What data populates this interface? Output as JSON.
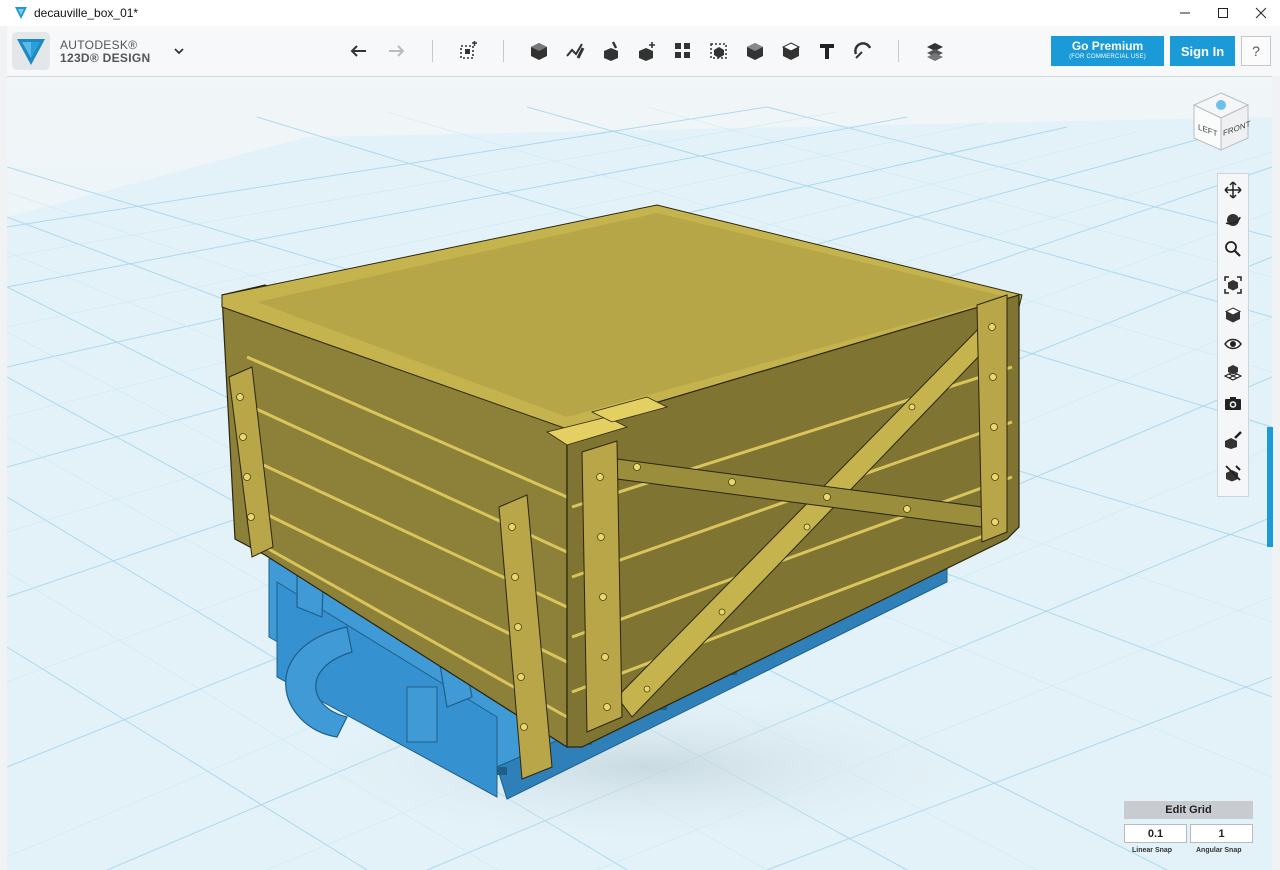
{
  "window": {
    "title": "decauville_box_01*",
    "controls": [
      "minimize",
      "maximize",
      "close"
    ]
  },
  "brand": {
    "line1": "AUTODESK®",
    "line2": "123D® DESIGN",
    "accent": "#1a9ad6"
  },
  "toolbar": {
    "tools": [
      "undo-icon",
      "redo-icon",
      "transform-icon",
      "primitives-icon",
      "sketch-icon",
      "construct-icon",
      "modify-icon",
      "pattern-icon",
      "group-icon",
      "combine-icon",
      "measure-icon",
      "text-icon",
      "snap-icon",
      "material-icon"
    ],
    "premium_label": "Go Premium",
    "premium_sub": "(FOR COMMERCIAL USE)",
    "signin_label": "Sign In",
    "help_label": "?"
  },
  "viewcube": {
    "left_label": "LEFT",
    "front_label": "FRONT"
  },
  "navbar": {
    "items": [
      "pan-icon",
      "orbit-icon",
      "zoom-icon",
      "fit-icon",
      "view-cube-icon",
      "visibility-icon",
      "grid-materials-icon",
      "camera-icon",
      "material-edit-icon",
      "hide-icon"
    ]
  },
  "edit_grid": {
    "title": "Edit Grid",
    "linear_snap_value": "0.1",
    "angular_snap_value": "1",
    "linear_snap_label": "Linear Snap",
    "angular_snap_label": "Angular Snap"
  },
  "colors": {
    "wood": "#8d8038",
    "wood_light": "#b9a84a",
    "chassis": "#3f9ad6",
    "grid_line": "#9fd2ea",
    "grid_bg": "#e8f3f7"
  }
}
